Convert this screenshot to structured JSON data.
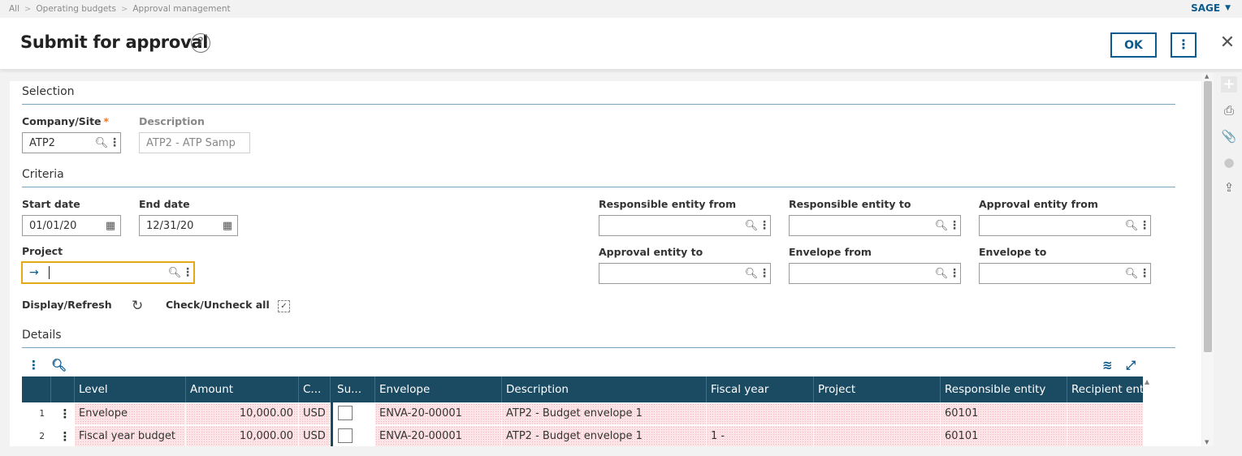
{
  "breadcrumb": [
    "All",
    "Operating budgets",
    "Approval management"
  ],
  "user": "SAGE",
  "page": {
    "title": "Submit for approval",
    "help_icon": "?",
    "ok_label": "OK",
    "more_label": "⋮",
    "close_label": "✕"
  },
  "selection": {
    "title": "Selection",
    "company_label": "Company/Site",
    "company_value": "ATP2",
    "description_label": "Description",
    "description_value": "ATP2 - ATP Samp"
  },
  "criteria": {
    "title": "Criteria",
    "start_label": "Start date",
    "start_value": "01/01/20",
    "end_label": "End date",
    "end_value": "12/31/20",
    "project_label": "Project",
    "project_value": "",
    "resp_from_label": "Responsible entity from",
    "resp_to_label": "Responsible entity to",
    "appr_from_label": "Approval entity from",
    "appr_to_label": "Approval entity to",
    "env_from_label": "Envelope from",
    "env_to_label": "Envelope to",
    "display_label": "Display/Refresh",
    "check_label": "Check/Uncheck all"
  },
  "details": {
    "title": "Details",
    "columns": [
      "Level",
      "Amount",
      "C...",
      "Su...",
      "Envelope",
      "Description",
      "Fiscal year",
      "Project",
      "Responsible entity",
      "Recipient enti"
    ],
    "rows": [
      {
        "num": "1",
        "level": "Envelope",
        "amount": "10,000.00",
        "currency": "USD",
        "envelope": "ENVA-20-00001",
        "description": "ATP2 - Budget envelope 1",
        "fiscal_year": "",
        "project": "",
        "responsible": "60101",
        "recipient": ""
      },
      {
        "num": "2",
        "level": "Fiscal year budget",
        "amount": "10,000.00",
        "currency": "USD",
        "envelope": "ENVA-20-00001",
        "description": "ATP2 - Budget envelope 1",
        "fiscal_year": "1 -",
        "project": "",
        "responsible": "60101",
        "recipient": ""
      }
    ]
  },
  "icons": {
    "search": "search-icon",
    "calendar": "calendar-icon",
    "refresh": "refresh-icon",
    "layers": "layers-icon",
    "expand": "expand-icon",
    "accent": "#0c5b8e",
    "header_bg": "#1b4a63",
    "focus": "#e3a919"
  }
}
